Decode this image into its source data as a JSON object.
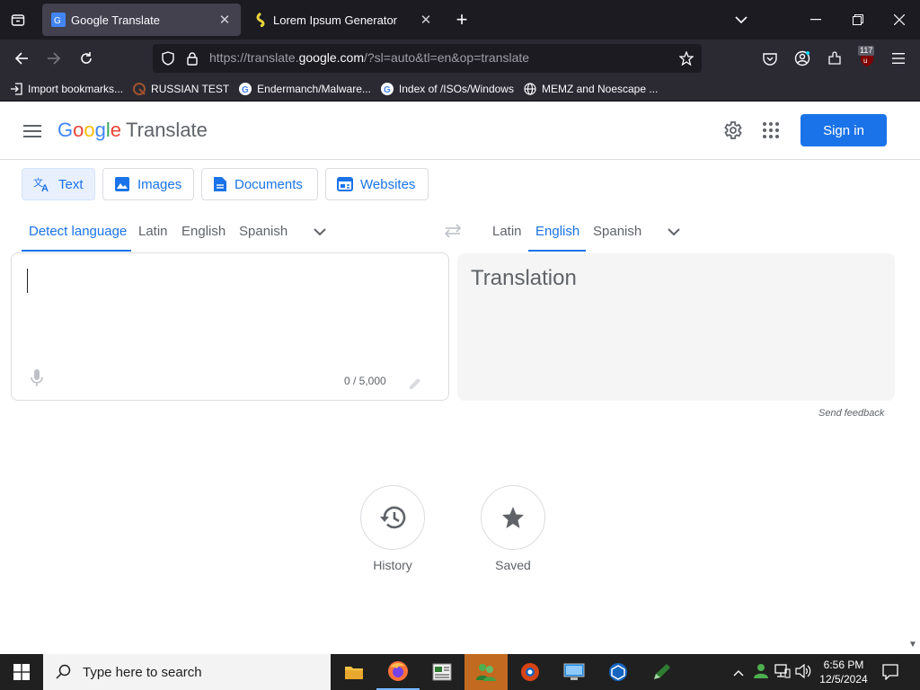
{
  "browser": {
    "tabs": [
      {
        "title": "Google Translate",
        "active": true
      },
      {
        "title": "Lorem Ipsum Generator",
        "active": false
      }
    ],
    "url": {
      "prefix": "https://translate.",
      "domain": "google.com",
      "suffix": "/?sl=auto&tl=en&op=translate"
    },
    "extension_badge": "117",
    "bookmarks": [
      {
        "label": "Import bookmarks...",
        "icon": "import-icon"
      },
      {
        "label": "RUSSIAN TEST",
        "icon": "russian-favicon"
      },
      {
        "label": "Endermanch/Malware...",
        "icon": "google-favicon"
      },
      {
        "label": "Index of /ISOs/Windows",
        "icon": "google-favicon"
      },
      {
        "label": "MEMZ and Noescape ...",
        "icon": "globe-icon"
      }
    ]
  },
  "header": {
    "logo_letters": [
      "G",
      "o",
      "o",
      "g",
      "l",
      "e"
    ],
    "product": "Translate",
    "signin_label": "Sign in"
  },
  "modes": [
    {
      "label": "Text",
      "icon": "translate-icon",
      "active": true
    },
    {
      "label": "Images",
      "icon": "image-icon",
      "active": false
    },
    {
      "label": "Documents",
      "icon": "document-icon",
      "active": false
    },
    {
      "label": "Websites",
      "icon": "website-icon",
      "active": false
    }
  ],
  "source_langs": [
    {
      "label": "Detect language",
      "selected": true
    },
    {
      "label": "Latin",
      "selected": false
    },
    {
      "label": "English",
      "selected": false
    },
    {
      "label": "Spanish",
      "selected": false
    }
  ],
  "target_langs": [
    {
      "label": "Latin",
      "selected": false
    },
    {
      "label": "English",
      "selected": true
    },
    {
      "label": "Spanish",
      "selected": false
    }
  ],
  "source": {
    "char_count": "0 / 5,000"
  },
  "target": {
    "placeholder": "Translation"
  },
  "feedback_label": "Send feedback",
  "quick_actions": [
    {
      "label": "History",
      "icon": "history-icon"
    },
    {
      "label": "Saved",
      "icon": "star-icon"
    }
  ],
  "taskbar": {
    "search_placeholder": "Type here to search",
    "time": "6:56 PM",
    "date": "12/5/2024"
  },
  "colors": {
    "accent": "#1a73e8",
    "chrome_dark": "#1c1b22",
    "taskbar_active": "#c26a20"
  }
}
